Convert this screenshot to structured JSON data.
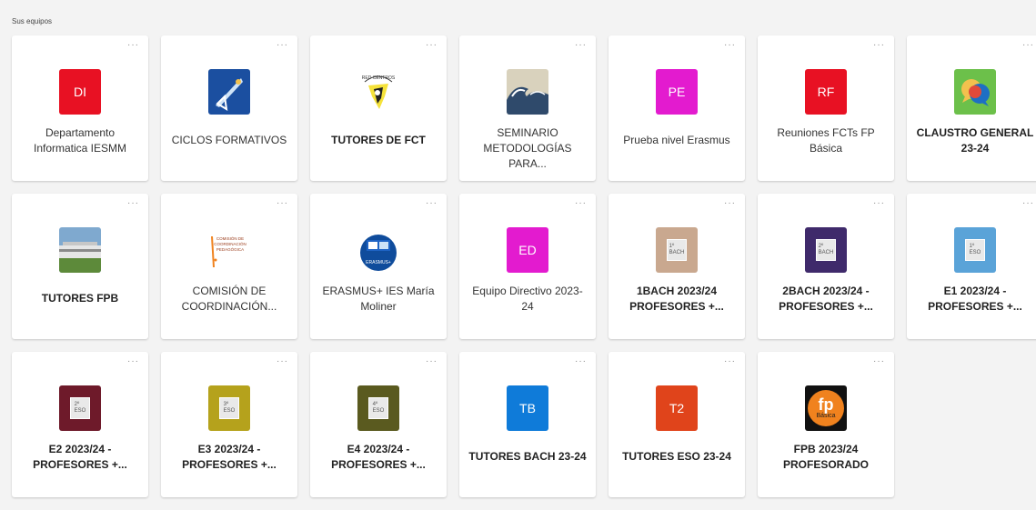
{
  "section_title": "Sus equipos",
  "more_label": "···",
  "teams": [
    {
      "name": "Departamento Informatica IESMM",
      "initials": "DI",
      "color": "#e81123",
      "bold": false,
      "icon": "initials"
    },
    {
      "name": "CICLOS FORMATIVOS",
      "initials": "",
      "color": "#1b4fa0",
      "bold": false,
      "icon": "ruler-icon"
    },
    {
      "name": "TUTORES DE FCT",
      "initials": "",
      "color": "#ffffff",
      "bold": true,
      "icon": "fct-logo-icon"
    },
    {
      "name": "SEMINARIO METODOLOGÍAS PARA...",
      "initials": "",
      "color": "#7b8a8f",
      "bold": false,
      "icon": "wave-image-icon"
    },
    {
      "name": "Prueba nivel Erasmus",
      "initials": "PE",
      "color": "#e31bcf",
      "bold": false,
      "icon": "initials"
    },
    {
      "name": "Reuniones FCTs FP Básica",
      "initials": "RF",
      "color": "#e81123",
      "bold": false,
      "icon": "initials"
    },
    {
      "name": "CLAUSTRO GENERAL 23-24",
      "initials": "",
      "color": "#6cc04a",
      "bold": true,
      "icon": "chat-bubbles-icon"
    },
    {
      "name": "TUTORES FPB",
      "initials": "",
      "color": "#4d7da8",
      "bold": true,
      "icon": "building-photo-icon"
    },
    {
      "name": "COMISIÓN DE COORDINACIÓN...",
      "initials": "",
      "color": "#ffffff",
      "bold": false,
      "icon": "comision-logo-icon"
    },
    {
      "name": "ERASMUS+ IES María Moliner",
      "initials": "",
      "color": "#ffffff",
      "bold": false,
      "icon": "erasmus-logo-icon"
    },
    {
      "name": "Equipo Directivo 2023-24",
      "initials": "ED",
      "color": "#e31bcf",
      "bold": false,
      "icon": "initials"
    },
    {
      "name": "1BACH 2023/24 PROFESORES +...",
      "initials": "",
      "color": "#c9a88f",
      "bold": true,
      "icon": "bach-badge-icon",
      "badge": "1º\nBACH"
    },
    {
      "name": "2BACH 2023/24 - PROFESORES +...",
      "initials": "",
      "color": "#3f2a6b",
      "bold": true,
      "icon": "bach-badge-icon",
      "badge": "2º\nBACH"
    },
    {
      "name": "E1 2023/24 - PROFESORES +...",
      "initials": "",
      "color": "#5aa3d8",
      "bold": true,
      "icon": "eso-badge-icon",
      "badge": "1º\nESO"
    },
    {
      "name": "E2 2023/24 - PROFESORES +...",
      "initials": "",
      "color": "#6e1a2a",
      "bold": true,
      "icon": "eso-badge-icon",
      "badge": "2º\nESO"
    },
    {
      "name": "E3 2023/24 - PROFESORES +...",
      "initials": "",
      "color": "#b5a21c",
      "bold": true,
      "icon": "eso-badge-icon",
      "badge": "3º\nESO"
    },
    {
      "name": "E4 2023/24 - PROFESORES +...",
      "initials": "",
      "color": "#5a5a1f",
      "bold": true,
      "icon": "eso-badge-icon",
      "badge": "4º\nESO"
    },
    {
      "name": "TUTORES BACH 23-24",
      "initials": "TB",
      "color": "#0f7bd9",
      "bold": true,
      "icon": "initials"
    },
    {
      "name": "TUTORES ESO 23-24",
      "initials": "T2",
      "color": "#e0441b",
      "bold": true,
      "icon": "initials"
    },
    {
      "name": "FPB 2023/24 PROFESORADO",
      "initials": "",
      "color": "#f0821e",
      "bold": true,
      "icon": "fp-logo-icon",
      "logo_text": "fp",
      "logo_sub": "Básica"
    }
  ]
}
